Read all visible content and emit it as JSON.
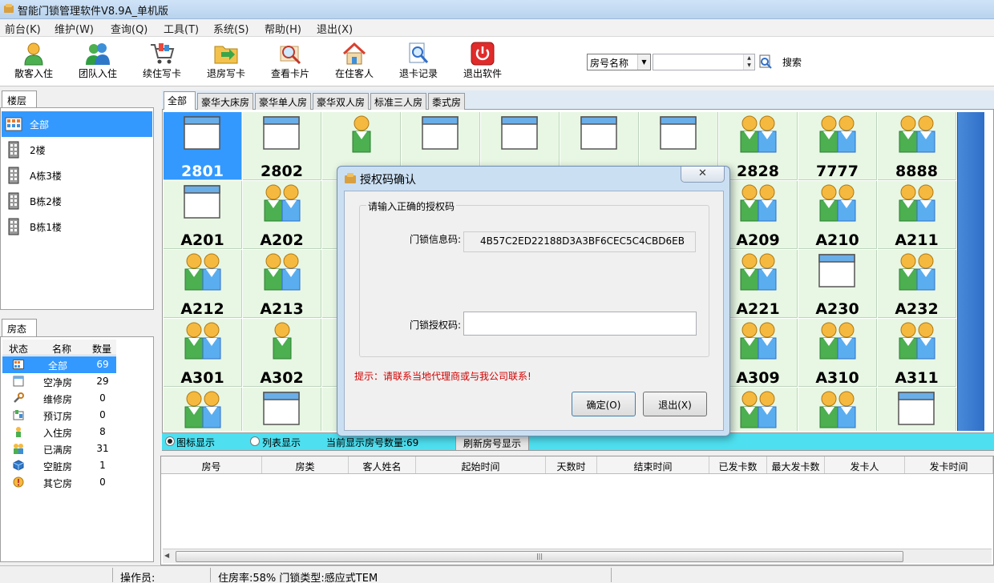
{
  "window": {
    "title": "智能门锁管理软件V8.9A_单机版"
  },
  "menu": [
    "前台(K)",
    "维护(W)",
    "查询(Q)",
    "工具(T)",
    "系统(S)",
    "帮助(H)",
    "退出(X)"
  ],
  "toolbar": {
    "items": [
      {
        "label": "散客入住",
        "icon": "single-guest-icon"
      },
      {
        "label": "团队入住",
        "icon": "team-guests-icon"
      },
      {
        "label": "续住写卡",
        "icon": "cart-icon"
      },
      {
        "label": "退房写卡",
        "icon": "checkout-folder-icon"
      },
      {
        "label": "查看卡片",
        "icon": "magnifier-icon"
      },
      {
        "label": "在住客人",
        "icon": "house-icon"
      },
      {
        "label": "退卡记录",
        "icon": "search-document-icon"
      },
      {
        "label": "退出软件",
        "icon": "power-icon"
      }
    ],
    "search_field_select": "房号名称",
    "search_value": "",
    "search_label": "搜索"
  },
  "floor_panel": {
    "tab": "楼层",
    "items": [
      "全部",
      "2楼",
      "A栋3楼",
      "B栋2楼",
      "B栋1楼"
    ],
    "selected": 0
  },
  "status_panel": {
    "tab": "房态",
    "headers": [
      "状态",
      "名称",
      "数量"
    ],
    "rows": [
      {
        "name": "全部",
        "count": "69",
        "icon": "all-grid-icon"
      },
      {
        "name": "空净房",
        "count": "29",
        "icon": "empty-room-icon"
      },
      {
        "name": "维修房",
        "count": "0",
        "icon": "wrench-icon"
      },
      {
        "name": "预订房",
        "count": "0",
        "icon": "reserve-icon"
      },
      {
        "name": "入住房",
        "count": "8",
        "icon": "single-guest-icon"
      },
      {
        "name": "已满房",
        "count": "31",
        "icon": "full-room-icon"
      },
      {
        "name": "空脏房",
        "count": "1",
        "icon": "dirty-cube-icon"
      },
      {
        "name": "其它房",
        "count": "0",
        "icon": "warning-icon"
      }
    ],
    "selected": 0
  },
  "room_tabs": [
    "全部",
    "豪华大床房",
    "豪华单人房",
    "豪华双人房",
    "标准三人房",
    "黍式房"
  ],
  "rooms": [
    {
      "no": "2801",
      "status": "empty"
    },
    {
      "no": "2802",
      "status": "empty"
    },
    {
      "no": "",
      "status": "single"
    },
    {
      "no": "",
      "status": "empty"
    },
    {
      "no": "",
      "status": "empty"
    },
    {
      "no": "",
      "status": "empty"
    },
    {
      "no": "",
      "status": "empty"
    },
    {
      "no": "2828",
      "status": "double"
    },
    {
      "no": "7777",
      "status": "double"
    },
    {
      "no": "8888",
      "status": "double"
    },
    {
      "no": "A201",
      "status": "empty"
    },
    {
      "no": "A202",
      "status": "double"
    },
    {
      "no": "",
      "status": "none"
    },
    {
      "no": "",
      "status": "none"
    },
    {
      "no": "",
      "status": "none"
    },
    {
      "no": "",
      "status": "none"
    },
    {
      "no": "",
      "status": "none"
    },
    {
      "no": "A209",
      "status": "double"
    },
    {
      "no": "A210",
      "status": "double"
    },
    {
      "no": "A211",
      "status": "double"
    },
    {
      "no": "A212",
      "status": "double"
    },
    {
      "no": "A213",
      "status": "double"
    },
    {
      "no": "",
      "status": "none"
    },
    {
      "no": "",
      "status": "none"
    },
    {
      "no": "",
      "status": "none"
    },
    {
      "no": "",
      "status": "none"
    },
    {
      "no": "",
      "status": "none"
    },
    {
      "no": "A221",
      "status": "double"
    },
    {
      "no": "A230",
      "status": "empty"
    },
    {
      "no": "A232",
      "status": "double"
    },
    {
      "no": "A301",
      "status": "double"
    },
    {
      "no": "A302",
      "status": "single"
    },
    {
      "no": "",
      "status": "none"
    },
    {
      "no": "",
      "status": "none"
    },
    {
      "no": "",
      "status": "none"
    },
    {
      "no": "",
      "status": "none"
    },
    {
      "no": "",
      "status": "none"
    },
    {
      "no": "A309",
      "status": "double"
    },
    {
      "no": "A310",
      "status": "double"
    },
    {
      "no": "A311",
      "status": "double"
    },
    {
      "no": "",
      "status": "double"
    },
    {
      "no": "",
      "status": "empty"
    },
    {
      "no": "",
      "status": "none"
    },
    {
      "no": "",
      "status": "none"
    },
    {
      "no": "",
      "status": "none"
    },
    {
      "no": "",
      "status": "none"
    },
    {
      "no": "",
      "status": "none"
    },
    {
      "no": "",
      "status": "double"
    },
    {
      "no": "",
      "status": "double"
    },
    {
      "no": "",
      "status": "empty"
    }
  ],
  "selected_room": "2801",
  "grid_footer": {
    "icon_view": "图标显示",
    "list_view": "列表显示",
    "count_text": "当前显示房号数量:69",
    "refresh": "刷新房号显示"
  },
  "list_headers": [
    "房号",
    "房类",
    "客人姓名",
    "起始时间",
    "天数时",
    "结束时间",
    "已发卡数",
    "最大发卡数",
    "发卡人",
    "发卡时间"
  ],
  "statusbar": {
    "operator": "操作员:",
    "info": "住房率:58% 门锁类型:感应式TEM"
  },
  "dialog": {
    "title": "授权码确认",
    "close": "✕",
    "group_label": "请输入正确的授权码",
    "info_label": "门锁信息码:",
    "info_value": "4B57C2ED22188D3A3BF6CEC5C4CBD6EB",
    "auth_label": "门锁授权码:",
    "auth_value": "",
    "hint": "提示：请联系当地代理商或与我公司联系!",
    "ok": "确定(O)",
    "cancel": "退出(X)"
  },
  "colors": {
    "accent": "#3399ff",
    "room_bg": "#e8f7e4",
    "cyan_bar": "#4ee0f0",
    "hint": "#d00000"
  }
}
